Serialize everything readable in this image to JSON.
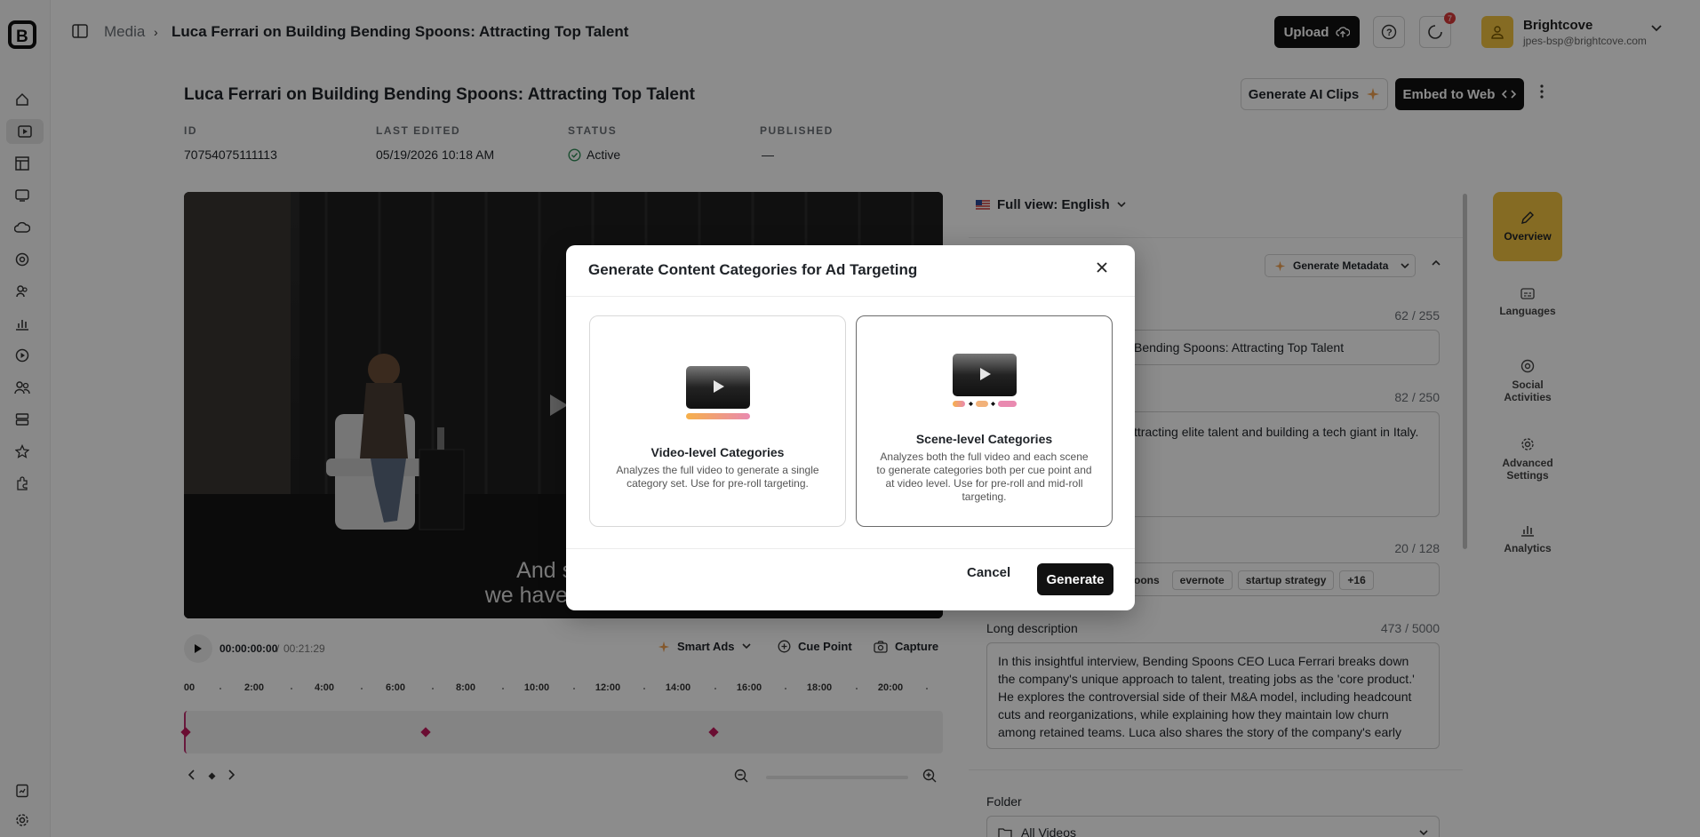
{
  "colors": {
    "accent": "#f3c440",
    "primary_button": "#111111",
    "cue_point": "#c2185b",
    "status_ok": "#2e8b57",
    "notification": "#d93a3a"
  },
  "sidebar": {
    "icons": [
      "logo-icon",
      "home-icon",
      "media-icon",
      "playlist-icon",
      "live-icon",
      "cloud-icon",
      "social-icon",
      "audience-icon",
      "analytics-icon",
      "player-icon",
      "users-icon",
      "server-icon",
      "star-icon",
      "plugin-icon",
      "report-icon",
      "settings-icon"
    ]
  },
  "topbar": {
    "breadcrumb_media": "Media",
    "breadcrumb_sep": "›",
    "breadcrumb_title": "Luca Ferrari on Building Bending Spoons: Attracting Top Talent",
    "upload_label": "Upload",
    "notification_count": "7",
    "account_name": "Brightcove",
    "account_email": "jpes-bsp@brightcove.com"
  },
  "header": {
    "title": "Luca Ferrari on Building Bending Spoons: Attracting Top Talent",
    "ai_clips_label": "Generate AI Clips",
    "embed_label": "Embed to Web"
  },
  "meta": {
    "id_label": "ID",
    "id_value": "70754075111113",
    "edited_label": "LAST EDITED",
    "edited_value": "05/19/2026 10:18 AM",
    "status_label": "STATUS",
    "status_value": "Active",
    "published_label": "PUBLISHED",
    "published_value": "—"
  },
  "video": {
    "caption_line1": "And so, u",
    "caption_line2": "we have never t"
  },
  "player": {
    "timecode": "00:00:00:00",
    "sep": "/",
    "duration": "00:21:29",
    "smart_ads_label": "Smart Ads",
    "cue_point_label": "Cue Point",
    "capture_label": "Capture",
    "ticks": [
      "00",
      "2:00",
      "4:00",
      "6:00",
      "8:00",
      "10:00",
      "12:00",
      "14:00",
      "16:00",
      "18:00",
      "20:00"
    ]
  },
  "panel": {
    "language_label": "Full view: English",
    "generate_metadata_label": "Generate Metadata",
    "name_count": "62 / 255",
    "name_value": "Bending Spoons: Attracting Top Talent",
    "short_desc_count": "82 / 250",
    "short_desc_value": "ttracting elite talent and building a tech giant in Italy.",
    "tags_count": "20 / 128",
    "tags": [
      "oons",
      "evernote",
      "startup strategy",
      "+16"
    ],
    "long_desc_label": "Long description",
    "long_desc_count": "473 / 5000",
    "long_desc_value": "In this insightful interview, Bending Spoons CEO Luca Ferrari breaks down the company's unique approach to talent, treating jobs as the 'core product.' He explores the controversial side of their M&A model, including headcount cuts and reorganizations, while explaining how they maintain low churn among retained teams. Luca also shares the story of the company's early",
    "folder_label": "Folder",
    "folder_value": "All Videos"
  },
  "side_tabs": [
    {
      "label": "Overview"
    },
    {
      "label": "Languages"
    },
    {
      "label": "Social Activities"
    },
    {
      "label": "Advanced Settings"
    },
    {
      "label": "Analytics"
    }
  ],
  "modal": {
    "title": "Generate Content Categories for Ad Targeting",
    "option_video_title": "Video-level Categories",
    "option_video_desc": "Analyzes the full video to generate a single category set. Use for pre-roll targeting.",
    "option_scene_title": "Scene-level Categories",
    "option_scene_desc": "Analyzes both the full video and each scene to generate categories both per cue point and at video level. Use for pre-roll and mid-roll targeting.",
    "cancel_label": "Cancel",
    "generate_label": "Generate"
  }
}
